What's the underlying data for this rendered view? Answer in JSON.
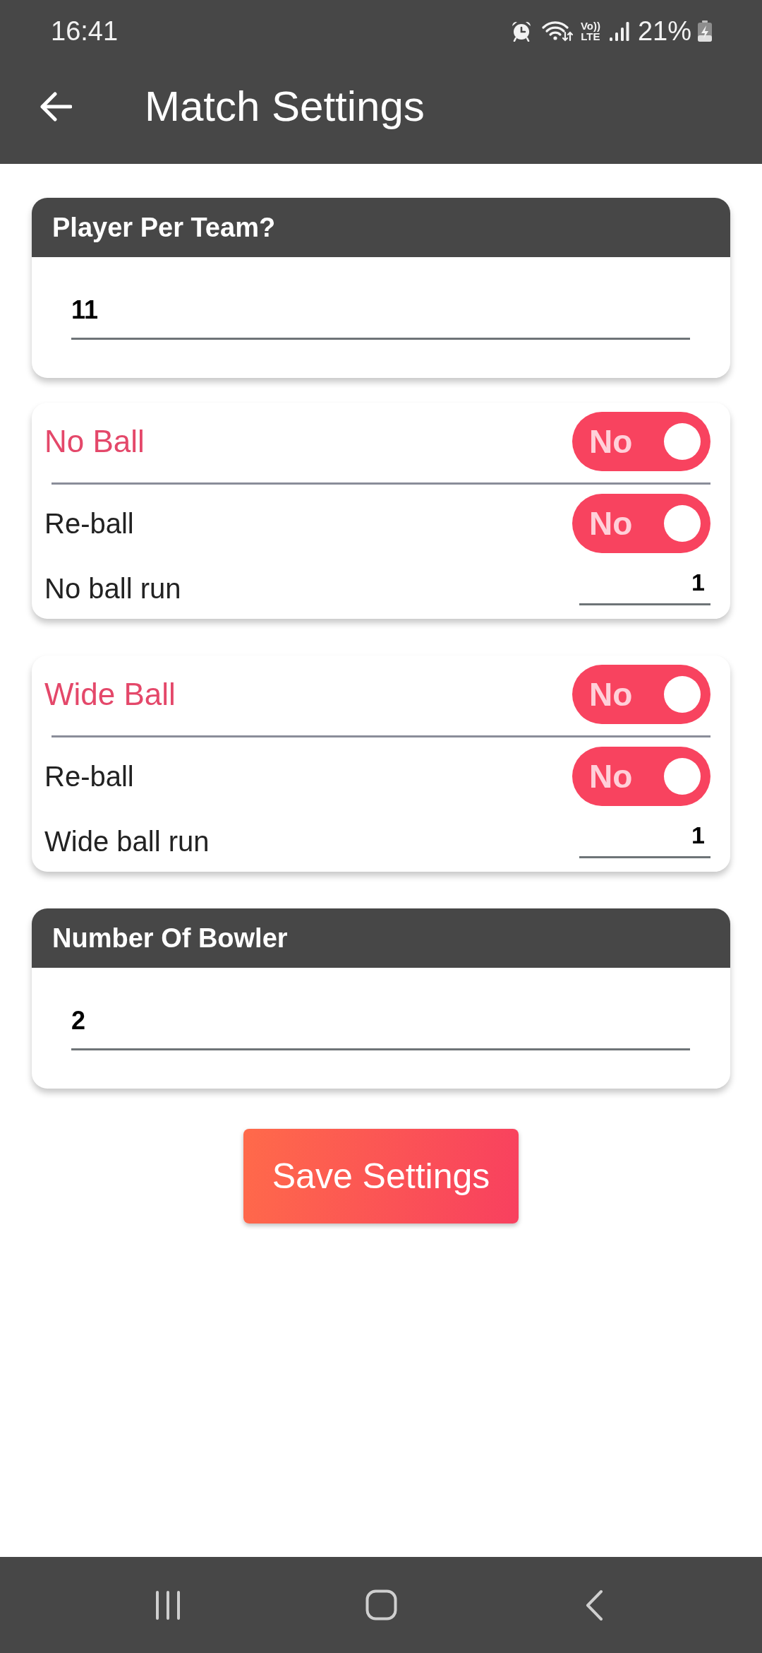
{
  "status_bar": {
    "time": "16:41",
    "network_type": [
      "Vo))",
      "LTE"
    ],
    "battery": "21%"
  },
  "app_bar": {
    "title": "Match Settings"
  },
  "cards": [
    {
      "kind": "input",
      "title": "Player Per Team?",
      "value": "11"
    },
    {
      "kind": "section",
      "title": "No Ball",
      "toggle": {
        "label": "No",
        "on": false
      },
      "rows": [
        {
          "kind": "toggle",
          "label": "Re-ball",
          "toggle": {
            "label": "No",
            "on": false
          }
        },
        {
          "kind": "field",
          "label": "No ball run",
          "value": "1"
        }
      ]
    },
    {
      "kind": "section",
      "title": "Wide Ball",
      "toggle": {
        "label": "No",
        "on": false
      },
      "rows": [
        {
          "kind": "toggle",
          "label": "Re-ball",
          "toggle": {
            "label": "No",
            "on": false
          }
        },
        {
          "kind": "field",
          "label": "Wide ball run",
          "value": "1"
        }
      ]
    },
    {
      "kind": "input",
      "title": "Number Of Bowler",
      "value": "2"
    }
  ],
  "save_button": {
    "label": "Save Settings"
  }
}
